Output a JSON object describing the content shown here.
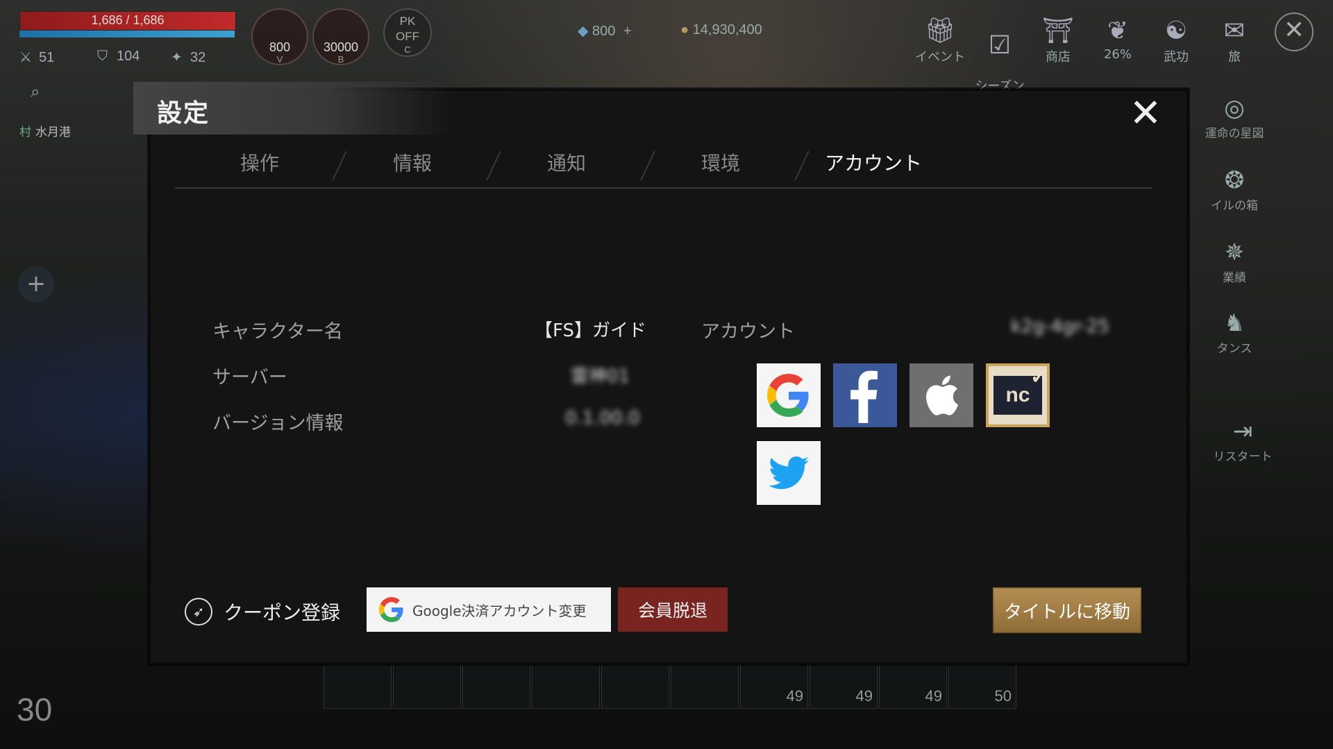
{
  "hud": {
    "hp_text": "1,686 / 1,686",
    "stats": [
      {
        "icon": "crossed-swords-icon",
        "value": "51"
      },
      {
        "icon": "shield-icon",
        "value": "104"
      },
      {
        "icon": "star-icon",
        "value": "32"
      }
    ],
    "potions": [
      {
        "count": "800",
        "key": "V"
      },
      {
        "count": "30000",
        "key": "B"
      }
    ],
    "pk": {
      "line1": "PK",
      "line2": "OFF",
      "key": "C"
    },
    "diamonds": "800",
    "gold": "14,930,400",
    "location_tag": "村",
    "location": "水月港",
    "level": "30"
  },
  "top_menu": [
    {
      "label": "イベント",
      "icon": "gift-icon"
    },
    {
      "label": "シーズン\nパス",
      "icon": "season-pass-icon"
    },
    {
      "label": "商店",
      "icon": "shop-icon"
    },
    {
      "label": "26%",
      "icon": "bag-icon"
    },
    {
      "label": "武功",
      "icon": "martial-icon"
    },
    {
      "label": "旅",
      "icon": "journey-icon"
    }
  ],
  "side_menu": [
    {
      "label": "運命の星図",
      "icon": "star-chart-icon"
    },
    {
      "label": "イルの箱",
      "icon": "box-icon"
    },
    {
      "label": "業績",
      "icon": "achievement-icon"
    },
    {
      "label": "タンス",
      "icon": "wardrobe-icon"
    },
    {
      "label": "リスタート",
      "icon": "restart-icon"
    }
  ],
  "hotbar": [
    {
      "n": ""
    },
    {
      "n": ""
    },
    {
      "n": ""
    },
    {
      "n": ""
    },
    {
      "n": ""
    },
    {
      "n": ""
    },
    {
      "n": "49"
    },
    {
      "n": "49"
    },
    {
      "n": "49"
    },
    {
      "n": "50"
    }
  ],
  "dialog": {
    "title": "設定",
    "tabs": [
      "操作",
      "情報",
      "通知",
      "環境",
      "アカウント"
    ],
    "active_tab": "アカウント",
    "character_label": "キャラクター名",
    "character_value": "【FS】ガイド",
    "server_label": "サーバー",
    "server_value": "雷神01",
    "version_label": "バージョン情報",
    "version_value": "0.1.00.0",
    "account_label": "アカウント",
    "account_value": "k2g-4gr-25",
    "providers": [
      "google",
      "facebook",
      "apple",
      "ncsoft",
      "twitter"
    ],
    "coupon_label": "クーポン登録",
    "google_pay_label": "Google決済アカウント変更",
    "withdraw_label": "会員脱退",
    "title_label": "タイトルに移動"
  }
}
